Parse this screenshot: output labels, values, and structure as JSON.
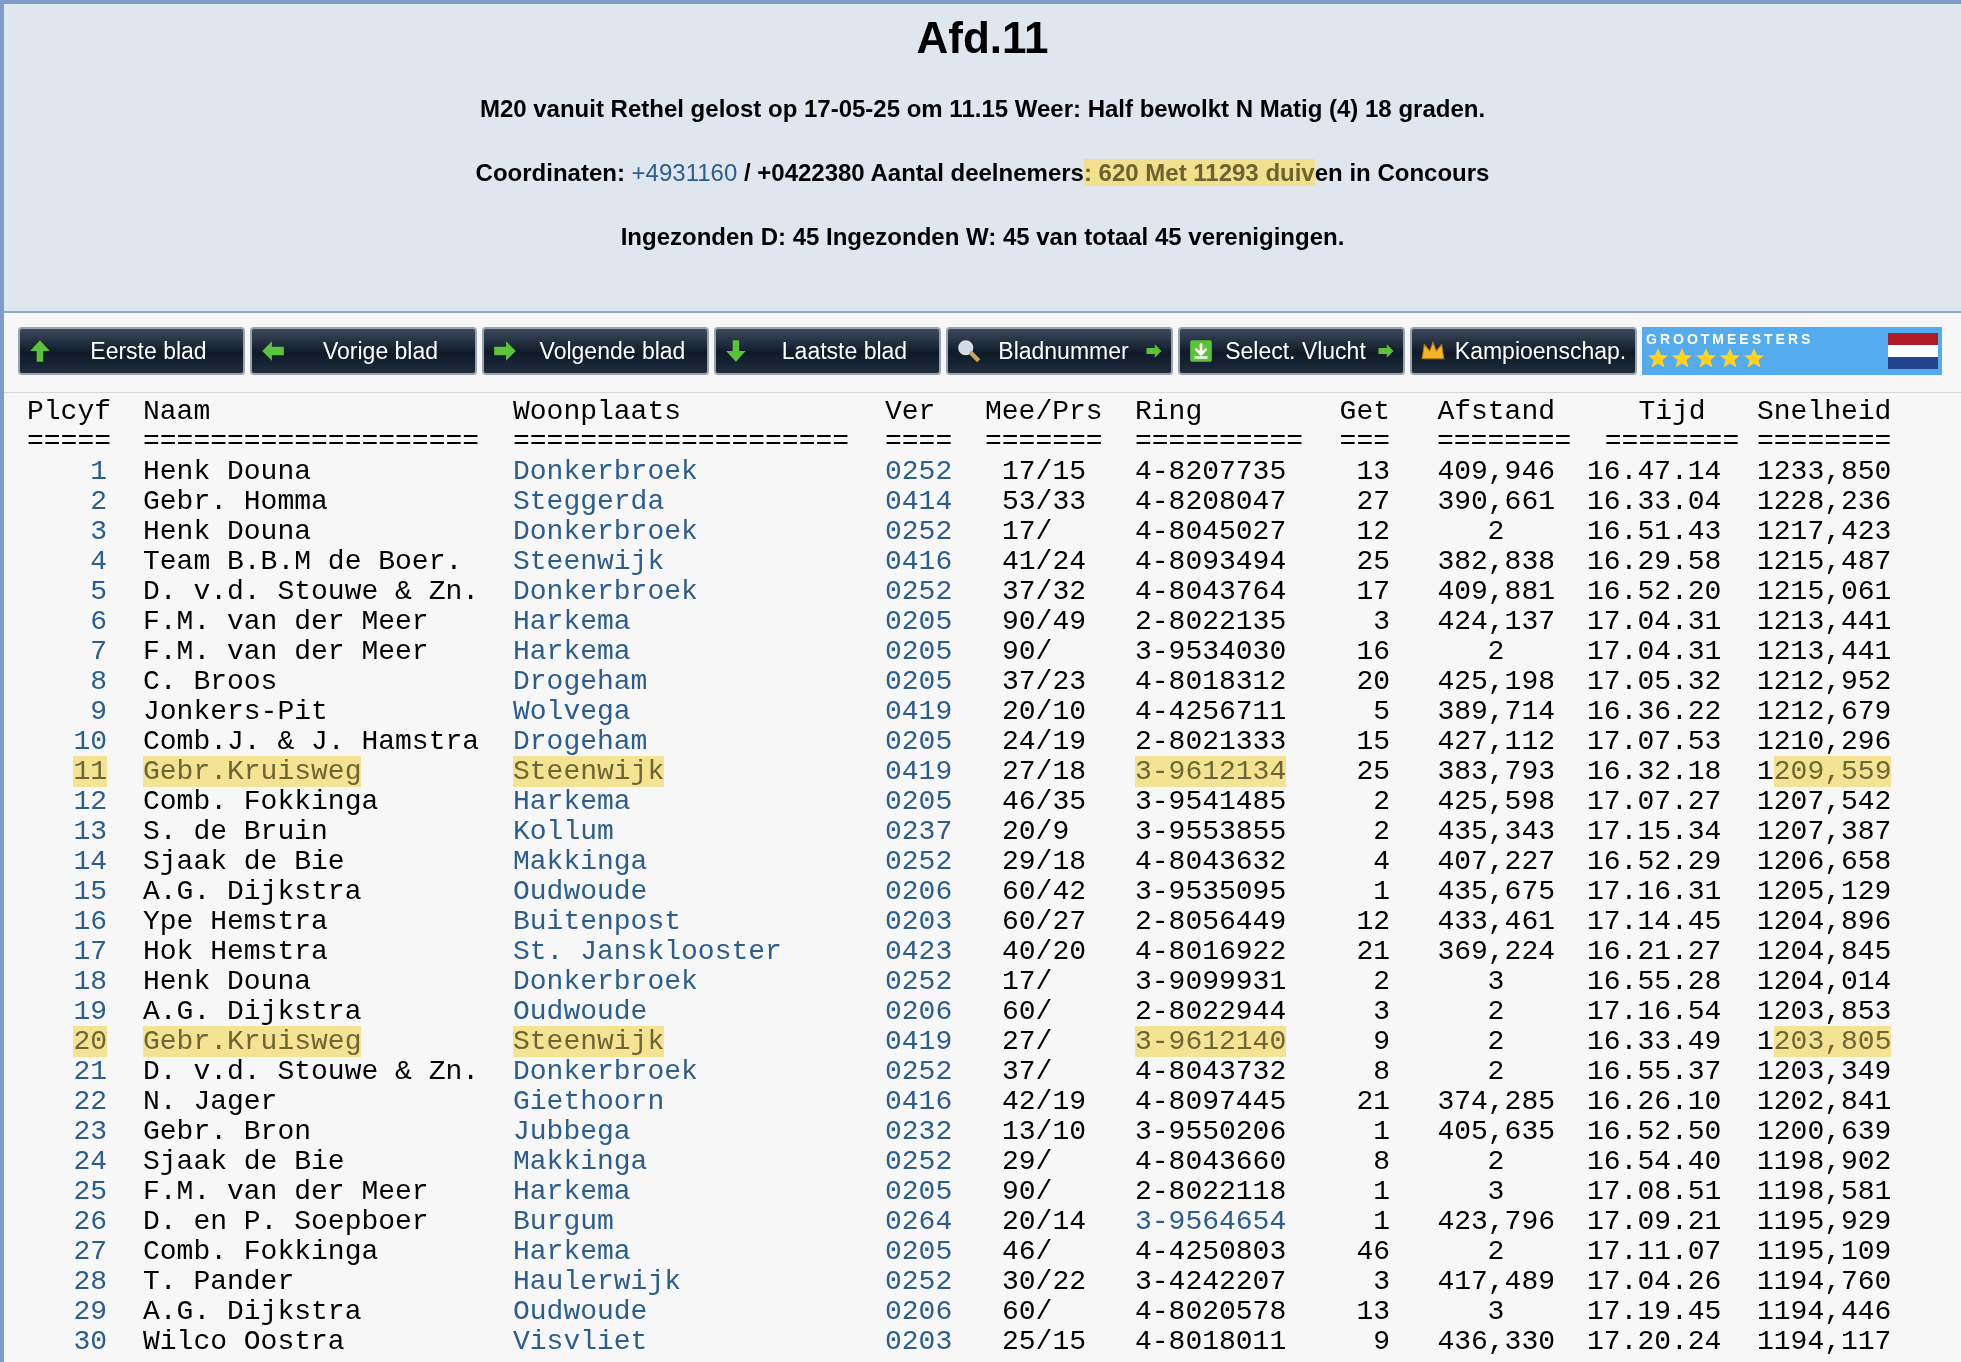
{
  "title": "Afd.11",
  "info_lines": [
    [
      {
        "text": "M20 vanuit Rethel gelost op 17-05-25 om 11.15 Weer: Half bewolkt N Matig (4) 18 graden.",
        "kind": "text"
      }
    ],
    [
      {
        "text": "Coordinaten: ",
        "kind": "text"
      },
      {
        "text": "+4931160",
        "kind": "link"
      },
      {
        "text": " / +0422380 Aantal deelnemers",
        "kind": "text"
      },
      {
        "text": ": 620 Met 11293 duiv",
        "kind": "marked"
      },
      {
        "text": "en in Concours",
        "kind": "text"
      }
    ],
    [
      {
        "text": "Ingezonden D: 45 Ingezonden W: 45 van totaal 45 verenigingen.",
        "kind": "text"
      }
    ]
  ],
  "toolbar": [
    "Eerste blad",
    "Vorige blad",
    "Volgende blad",
    "Laatste blad",
    "Bladnummer",
    "Select. Vlucht",
    "Kampioenschap."
  ],
  "badge": {
    "text": "GROOTMEESTERS",
    "stars": 5
  },
  "table": {
    "columns": [
      {
        "label": "Plcyf",
        "rule": "====="
      },
      {
        "label": "Naam",
        "rule": "===================="
      },
      {
        "label": "Woonplaats",
        "rule": "===================="
      },
      {
        "label": "Ver",
        "rule": "===="
      },
      {
        "label": "Mee/Prs",
        "rule": "======="
      },
      {
        "label": "Ring",
        "rule": "=========="
      },
      {
        "label": "Get",
        "rule": "==="
      },
      {
        "label": "Afstand",
        "rule": "========"
      },
      {
        "label": "Tijd",
        "rule": "========"
      },
      {
        "label": "Snelheid",
        "rule": "========"
      }
    ],
    "rows": [
      {
        "cells": [
          "1",
          "Henk Douna",
          "Donkerbroek",
          "0252",
          "17/15",
          "4-8207735",
          "13",
          "409,946",
          "16.47.14",
          "1233,850"
        ],
        "marked": false,
        "ring_link": false
      },
      {
        "cells": [
          "2",
          "Gebr. Homma",
          "Steggerda",
          "0414",
          "53/33",
          "4-8208047",
          "27",
          "390,661",
          "16.33.04",
          "1228,236"
        ],
        "marked": false,
        "ring_link": false
      },
      {
        "cells": [
          "3",
          "Henk Douna",
          "Donkerbroek",
          "0252",
          "17/",
          "4-8045027",
          "12",
          "2",
          "16.51.43",
          "1217,423"
        ],
        "marked": false,
        "ring_link": false
      },
      {
        "cells": [
          "4",
          "Team B.B.M de Boer.",
          "Steenwijk",
          "0416",
          "41/24",
          "4-8093494",
          "25",
          "382,838",
          "16.29.58",
          "1215,487"
        ],
        "marked": false,
        "ring_link": false
      },
      {
        "cells": [
          "5",
          "D. v.d. Stouwe & Zn.",
          "Donkerbroek",
          "0252",
          "37/32",
          "4-8043764",
          "17",
          "409,881",
          "16.52.20",
          "1215,061"
        ],
        "marked": false,
        "ring_link": false
      },
      {
        "cells": [
          "6",
          "F.M. van der Meer",
          "Harkema",
          "0205",
          "90/49",
          "2-8022135",
          "3",
          "424,137",
          "17.04.31",
          "1213,441"
        ],
        "marked": false,
        "ring_link": false
      },
      {
        "cells": [
          "7",
          "F.M. van der Meer",
          "Harkema",
          "0205",
          "90/",
          "3-9534030",
          "16",
          "2",
          "17.04.31",
          "1213,441"
        ],
        "marked": false,
        "ring_link": false
      },
      {
        "cells": [
          "8",
          "C. Broos",
          "Drogeham",
          "0205",
          "37/23",
          "4-8018312",
          "20",
          "425,198",
          "17.05.32",
          "1212,952"
        ],
        "marked": false,
        "ring_link": false
      },
      {
        "cells": [
          "9",
          "Jonkers-Pit",
          "Wolvega",
          "0419",
          "20/10",
          "4-4256711",
          "5",
          "389,714",
          "16.36.22",
          "1212,679"
        ],
        "marked": false,
        "ring_link": false
      },
      {
        "cells": [
          "10",
          "Comb.J. & J. Hamstra",
          "Drogeham",
          "0205",
          "24/19",
          "2-8021333",
          "15",
          "427,112",
          "17.07.53",
          "1210,296"
        ],
        "marked": false,
        "ring_link": false
      },
      {
        "cells": [
          "11",
          "Gebr.Kruisweg",
          "Steenwijk",
          "0419",
          "27/18",
          "3-9612134",
          "25",
          "383,793",
          "16.32.18",
          "1209,559"
        ],
        "marked": true,
        "ring_link": false
      },
      {
        "cells": [
          "12",
          "Comb. Fokkinga",
          "Harkema",
          "0205",
          "46/35",
          "3-9541485",
          "2",
          "425,598",
          "17.07.27",
          "1207,542"
        ],
        "marked": false,
        "ring_link": false
      },
      {
        "cells": [
          "13",
          "S. de Bruin",
          "Kollum",
          "0237",
          "20/9",
          "3-9553855",
          "2",
          "435,343",
          "17.15.34",
          "1207,387"
        ],
        "marked": false,
        "ring_link": false
      },
      {
        "cells": [
          "14",
          "Sjaak de Bie",
          "Makkinga",
          "0252",
          "29/18",
          "4-8043632",
          "4",
          "407,227",
          "16.52.29",
          "1206,658"
        ],
        "marked": false,
        "ring_link": false
      },
      {
        "cells": [
          "15",
          "A.G. Dijkstra",
          "Oudwoude",
          "0206",
          "60/42",
          "3-9535095",
          "1",
          "435,675",
          "17.16.31",
          "1205,129"
        ],
        "marked": false,
        "ring_link": false
      },
      {
        "cells": [
          "16",
          "Ype Hemstra",
          "Buitenpost",
          "0203",
          "60/27",
          "2-8056449",
          "12",
          "433,461",
          "17.14.45",
          "1204,896"
        ],
        "marked": false,
        "ring_link": false
      },
      {
        "cells": [
          "17",
          "Hok Hemstra",
          "St. Jansklooster",
          "0423",
          "40/20",
          "4-8016922",
          "21",
          "369,224",
          "16.21.27",
          "1204,845"
        ],
        "marked": false,
        "ring_link": false
      },
      {
        "cells": [
          "18",
          "Henk Douna",
          "Donkerbroek",
          "0252",
          "17/",
          "3-9099931",
          "2",
          "3",
          "16.55.28",
          "1204,014"
        ],
        "marked": false,
        "ring_link": false
      },
      {
        "cells": [
          "19",
          "A.G. Dijkstra",
          "Oudwoude",
          "0206",
          "60/",
          "2-8022944",
          "3",
          "2",
          "17.16.54",
          "1203,853"
        ],
        "marked": false,
        "ring_link": false
      },
      {
        "cells": [
          "20",
          "Gebr.Kruisweg",
          "Steenwijk",
          "0419",
          "27/",
          "3-9612140",
          "9",
          "2",
          "16.33.49",
          "1203,805"
        ],
        "marked": true,
        "ring_link": false
      },
      {
        "cells": [
          "21",
          "D. v.d. Stouwe & Zn.",
          "Donkerbroek",
          "0252",
          "37/",
          "4-8043732",
          "8",
          "2",
          "16.55.37",
          "1203,349"
        ],
        "marked": false,
        "ring_link": false
      },
      {
        "cells": [
          "22",
          "N. Jager",
          "Giethoorn",
          "0416",
          "42/19",
          "4-8097445",
          "21",
          "374,285",
          "16.26.10",
          "1202,841"
        ],
        "marked": false,
        "ring_link": false
      },
      {
        "cells": [
          "23",
          "Gebr. Bron",
          "Jubbega",
          "0232",
          "13/10",
          "3-9550206",
          "1",
          "405,635",
          "16.52.50",
          "1200,639"
        ],
        "marked": false,
        "ring_link": false
      },
      {
        "cells": [
          "24",
          "Sjaak de Bie",
          "Makkinga",
          "0252",
          "29/",
          "4-8043660",
          "8",
          "2",
          "16.54.40",
          "1198,902"
        ],
        "marked": false,
        "ring_link": false
      },
      {
        "cells": [
          "25",
          "F.M. van der Meer",
          "Harkema",
          "0205",
          "90/",
          "2-8022118",
          "1",
          "3",
          "17.08.51",
          "1198,581"
        ],
        "marked": false,
        "ring_link": false
      },
      {
        "cells": [
          "26",
          "D. en P. Soepboer",
          "Burgum",
          "0264",
          "20/14",
          "3-9564654",
          "1",
          "423,796",
          "17.09.21",
          "1195,929"
        ],
        "marked": false,
        "ring_link": true
      },
      {
        "cells": [
          "27",
          "Comb. Fokkinga",
          "Harkema",
          "0205",
          "46/",
          "4-4250803",
          "46",
          "2",
          "17.11.07",
          "1195,109"
        ],
        "marked": false,
        "ring_link": false
      },
      {
        "cells": [
          "28",
          "T. Pander",
          "Haulerwijk",
          "0252",
          "30/22",
          "3-4242207",
          "3",
          "417,489",
          "17.04.26",
          "1194,760"
        ],
        "marked": false,
        "ring_link": false
      },
      {
        "cells": [
          "29",
          "A.G. Dijkstra",
          "Oudwoude",
          "0206",
          "60/",
          "4-8020578",
          "13",
          "3",
          "17.19.45",
          "1194,446"
        ],
        "marked": false,
        "ring_link": false
      },
      {
        "cells": [
          "30",
          "Wilco Oostra",
          "Visvliet",
          "0203",
          "25/15",
          "4-8018011",
          "9",
          "436,330",
          "17.20.24",
          "1194,117"
        ],
        "marked": false,
        "ring_link": false
      }
    ]
  }
}
